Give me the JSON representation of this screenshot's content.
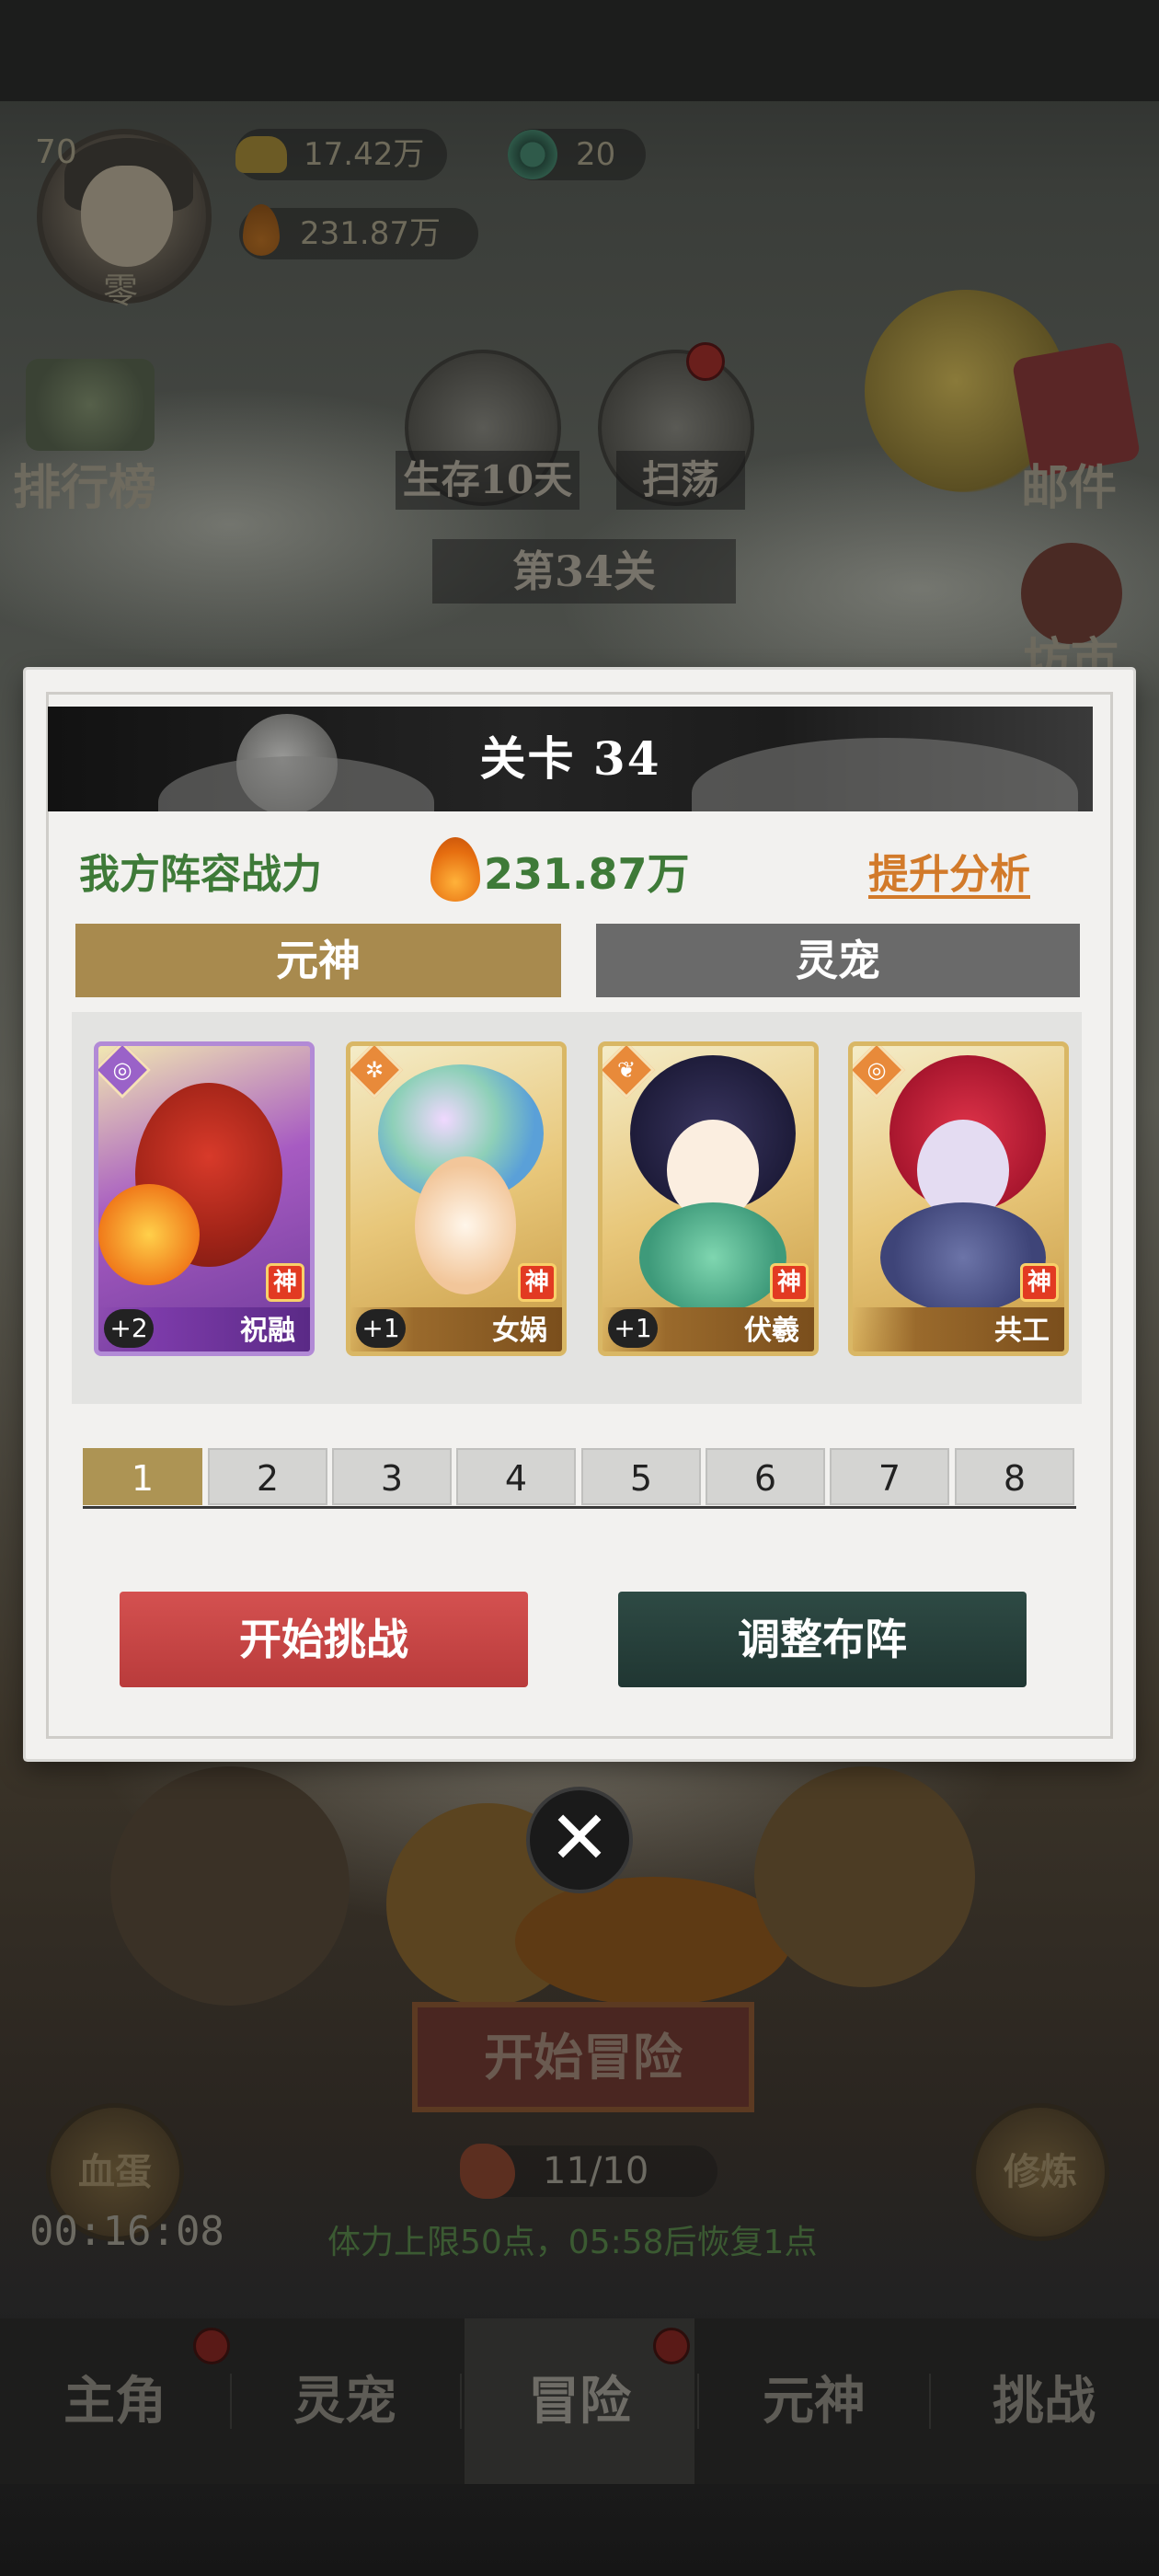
{
  "hud": {
    "player_level": "70",
    "player_name": "零",
    "gold": "17.42万",
    "jade": "20",
    "power": "231.87万"
  },
  "side_buttons": {
    "ranking": "排行榜",
    "mail": "邮件",
    "market": "坊市"
  },
  "mode_buttons": {
    "survive": "生存10天",
    "sweep": "扫荡"
  },
  "stage_banner": "第34关",
  "modal": {
    "title": "关卡 34",
    "power_label": "我方阵容战力",
    "power_value": "231.87万",
    "analysis_link": "提升分析",
    "tabs": [
      "元神",
      "灵宠"
    ],
    "cards": [
      {
        "name": "祝融",
        "plus": "+2",
        "badge": "神"
      },
      {
        "name": "女娲",
        "plus": "+1",
        "badge": "神"
      },
      {
        "name": "伏羲",
        "plus": "+1",
        "badge": "神"
      },
      {
        "name": "共工",
        "plus": "",
        "badge": "神"
      }
    ],
    "pages": [
      "1",
      "2",
      "3",
      "4",
      "5",
      "6",
      "7",
      "8"
    ],
    "start_challenge": "开始挑战",
    "adjust_formation": "调整布阵",
    "close_symbol": "✕"
  },
  "bottom": {
    "start_adventure": "开始冒险",
    "blood_egg": "血蛋",
    "train": "修炼",
    "timer": "00:16:08",
    "stamina": "11/10",
    "stamina_note": "体力上限50点，05:58后恢复1点"
  },
  "navbar": [
    "主角",
    "灵宠",
    "冒险",
    "元神",
    "挑战"
  ],
  "colors": {
    "accent_gold": "#a88a4e",
    "power_green": "#3e7a38",
    "link_orange": "#d27a2a",
    "button_red": "#c84646",
    "button_dark": "#26403b"
  }
}
